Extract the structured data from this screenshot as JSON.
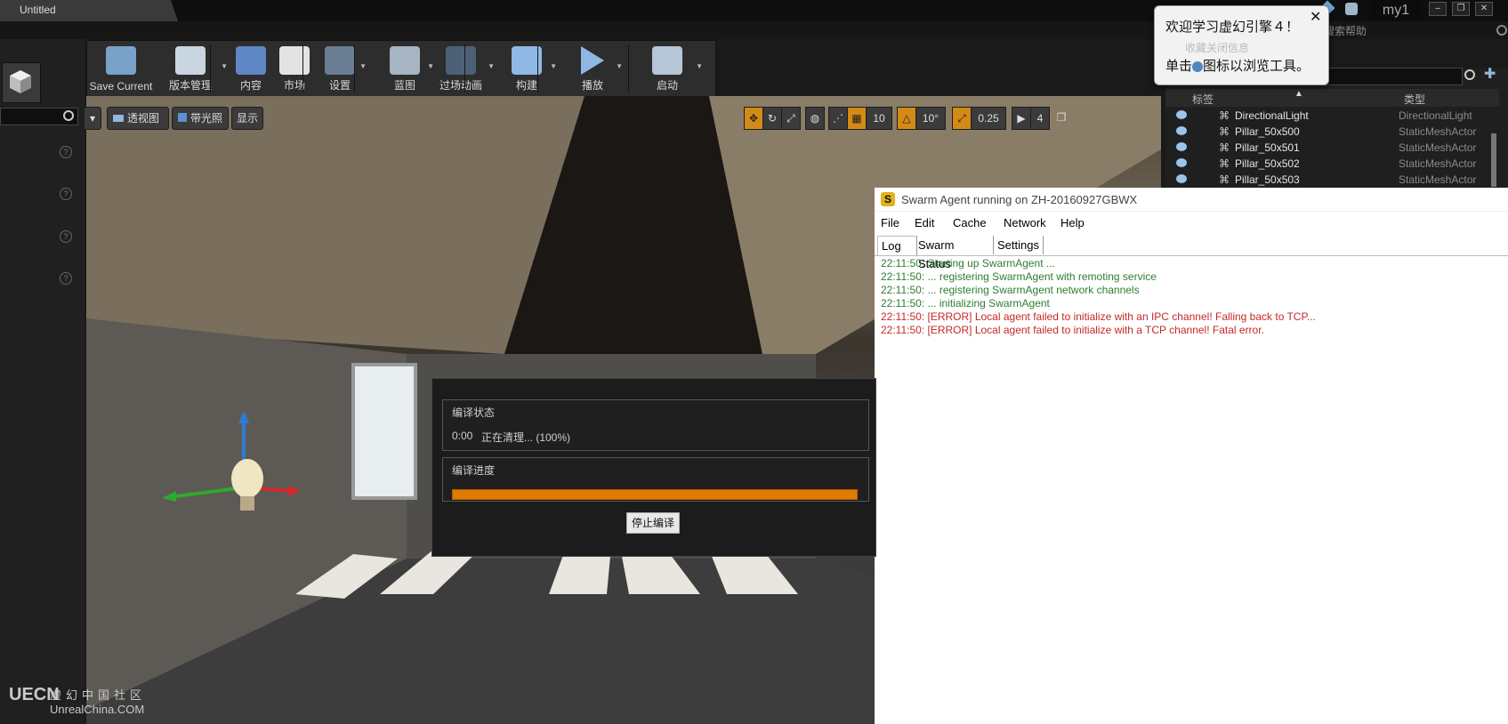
{
  "window": {
    "tab_title": "Untitled",
    "project_name": "my1",
    "help_search_placeholder": "搜索帮助"
  },
  "toolbar": {
    "buttons": [
      {
        "label": "Save Current",
        "icon": "save-icon"
      },
      {
        "label": "版本管理",
        "icon": "source-control-icon"
      },
      {
        "label": "内容",
        "icon": "content-icon"
      },
      {
        "label": "市场",
        "icon": "marketplace-icon"
      },
      {
        "label": "设置",
        "icon": "settings-icon"
      },
      {
        "label": "蓝图",
        "icon": "blueprint-icon"
      },
      {
        "label": "过场动画",
        "icon": "cinematics-icon"
      },
      {
        "label": "构建",
        "icon": "build-icon"
      },
      {
        "label": "播放",
        "icon": "play-icon"
      },
      {
        "label": "启动",
        "icon": "launch-icon"
      }
    ]
  },
  "viewport": {
    "perspective_label": "透视图",
    "lit_label": "带光照",
    "show_label": "显示",
    "grid_snap": "10",
    "rotation_snap": "10°",
    "scale_snap": "0.25",
    "camera_speed": "4"
  },
  "outliner": {
    "columns": {
      "label": "标签",
      "type": "类型"
    },
    "rows": [
      {
        "name": "DirectionalLight",
        "type": "DirectionalLight"
      },
      {
        "name": "Pillar_50x500",
        "type": "StaticMeshActor"
      },
      {
        "name": "Pillar_50x501",
        "type": "StaticMeshActor"
      },
      {
        "name": "Pillar_50x502",
        "type": "StaticMeshActor"
      },
      {
        "name": "Pillar_50x503",
        "type": "StaticMeshActor"
      }
    ]
  },
  "tooltip": {
    "line1": "欢迎学习虚幻引擎４！",
    "line2_prefix": "单击",
    "line2_suffix": "图标以浏览工具。",
    "behind_text": "收藏关闭信息"
  },
  "swarm": {
    "title": "Swarm Agent running on ZH-20160927GBWX",
    "menu": [
      "File",
      "Edit",
      "Cache",
      "Network",
      "Help"
    ],
    "tabs": [
      "Log",
      "Swarm Status",
      "Settings"
    ],
    "log": [
      {
        "text": "22:11:50: Starting up SwarmAgent ...",
        "level": "info"
      },
      {
        "text": "22:11:50:  ... registering SwarmAgent with remoting service",
        "level": "info"
      },
      {
        "text": "22:11:50:  ... registering SwarmAgent network channels",
        "level": "info"
      },
      {
        "text": "22:11:50:  ... initializing SwarmAgent",
        "level": "info"
      },
      {
        "text": "22:11:50: [ERROR] Local agent failed to initialize with an IPC channel! Falling back to TCP...",
        "level": "error"
      },
      {
        "text": "22:11:50: [ERROR] Local agent failed to initialize with a TCP channel! Fatal error.",
        "level": "error"
      }
    ],
    "colors": {
      "info": "#2e7d32",
      "error": "#c62828"
    }
  },
  "build_dialog": {
    "status_group": "编译状态",
    "status_time": "0:00",
    "status_text": "正在清理... (100%)",
    "progress_group": "编译进度",
    "progress_fraction": 1.0,
    "stop_button": "停止编译"
  },
  "watermark": {
    "logo": "UECN",
    "cn": "虚幻中国社区",
    "url": "UnrealChina.COM"
  },
  "colors": {
    "accent_orange": "#e07a00",
    "panel_bg": "#202020"
  }
}
